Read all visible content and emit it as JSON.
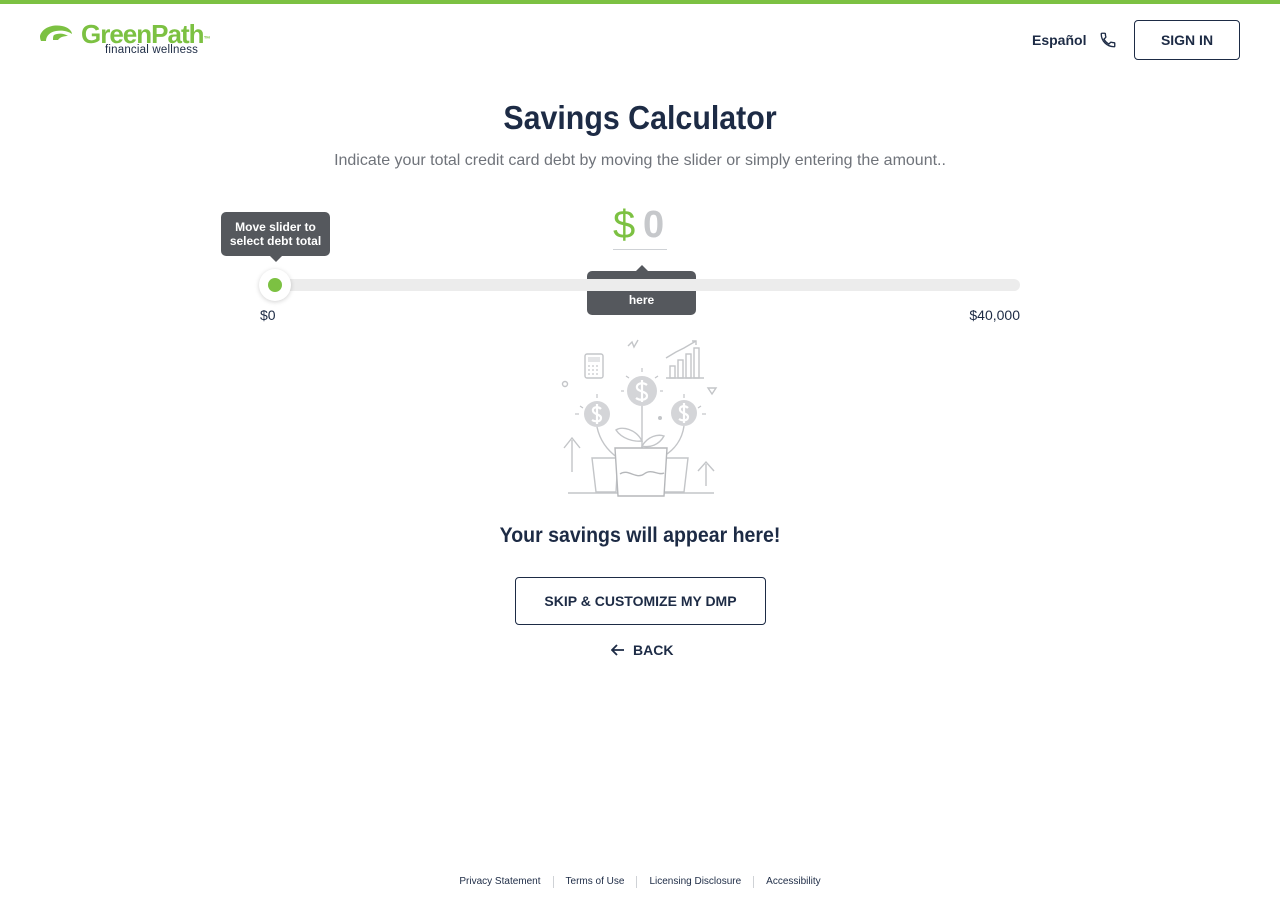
{
  "header": {
    "logo_name": "GreenPath",
    "logo_tm": "™",
    "logo_tagline": "financial wellness",
    "language_link": "Español",
    "phone_icon": "phone-icon",
    "sign_in_label": "SIGN IN"
  },
  "main": {
    "title": "Savings Calculator",
    "subtitle": "Indicate your total credit card debt by moving the slider or simply entering the amount..",
    "currency_symbol": "$",
    "amount_value": "0",
    "slider_tooltip": "Move slider to select debt total",
    "input_tooltip": "Enter debt total here",
    "slider": {
      "min_label": "$0",
      "max_label": "$40,000",
      "value": 0,
      "min": 0,
      "max": 40000
    },
    "illustration": "money-plant-illustration",
    "savings_message": "Your savings will appear here!",
    "skip_button": "SKIP & CUSTOMIZE MY DMP",
    "back_link": "BACK"
  },
  "footer": {
    "links": [
      "Privacy Statement",
      "Terms of Use",
      "Licensing Disclosure",
      "Accessibility"
    ]
  },
  "colors": {
    "accent_green": "#7cc142",
    "navy": "#1d2b45",
    "tooltip_bg": "#55585d"
  }
}
